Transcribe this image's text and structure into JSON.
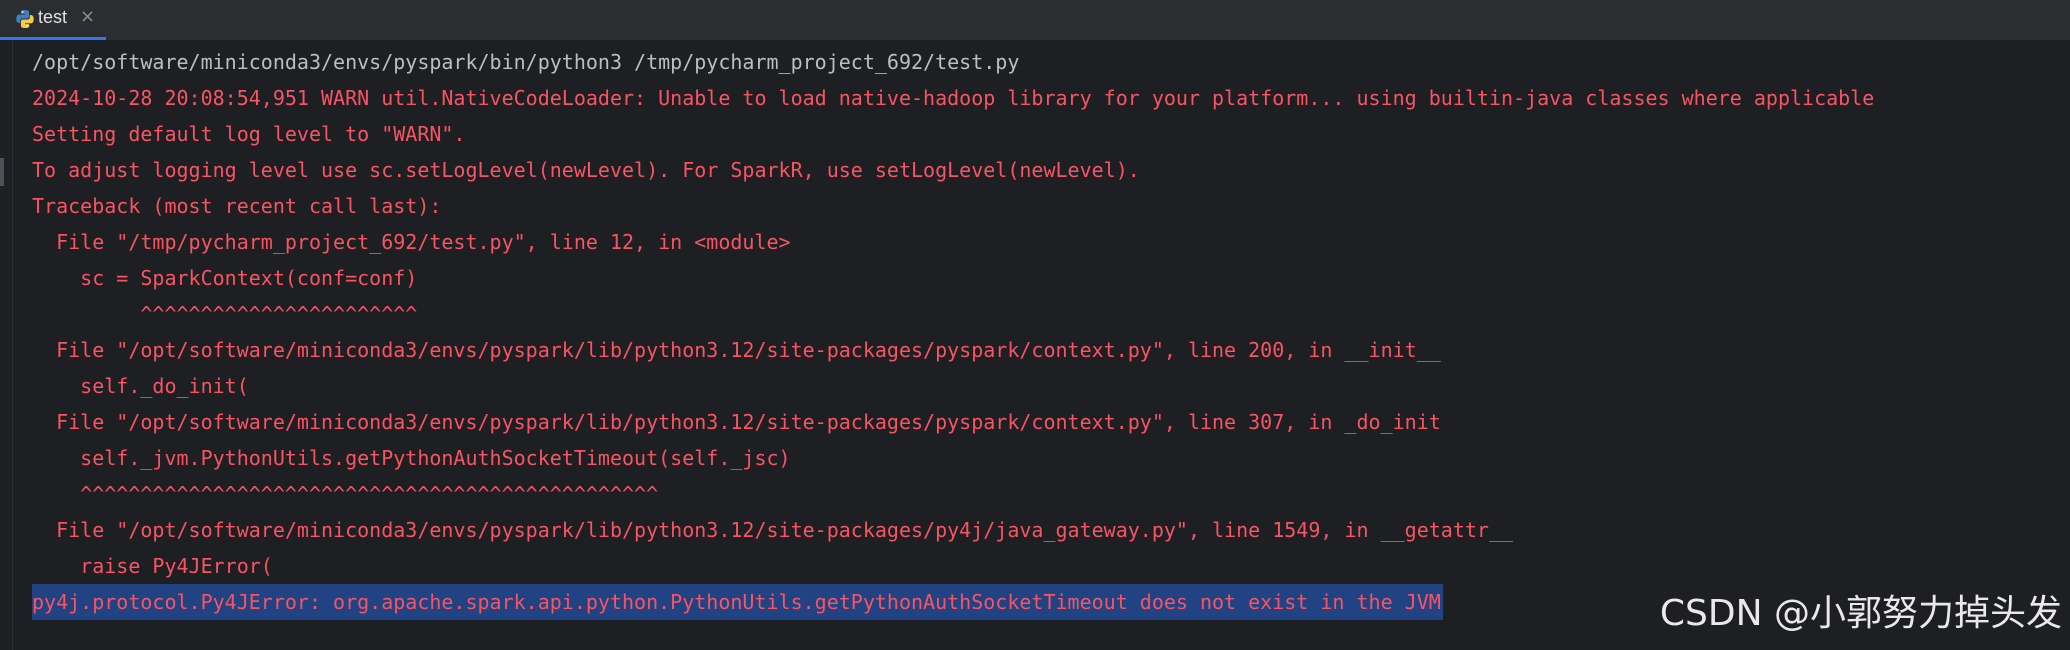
{
  "tab": {
    "label": "test",
    "close_glyph": "×",
    "icon": "python-icon"
  },
  "console": {
    "lines": [
      "/opt/software/miniconda3/envs/pyspark/bin/python3 /tmp/pycharm_project_692/test.py",
      "2024-10-28 20:08:54,951 WARN util.NativeCodeLoader: Unable to load native-hadoop library for your platform... using builtin-java classes where applicable",
      "Setting default log level to \"WARN\".",
      "To adjust logging level use sc.setLogLevel(newLevel). For SparkR, use setLogLevel(newLevel).",
      "Traceback (most recent call last):",
      "  File \"/tmp/pycharm_project_692/test.py\", line 12, in <module>",
      "    sc = SparkContext(conf=conf)",
      "         ^^^^^^^^^^^^^^^^^^^^^^^",
      "  File \"/opt/software/miniconda3/envs/pyspark/lib/python3.12/site-packages/pyspark/context.py\", line 200, in __init__",
      "    self._do_init(",
      "  File \"/opt/software/miniconda3/envs/pyspark/lib/python3.12/site-packages/pyspark/context.py\", line 307, in _do_init",
      "    self._jvm.PythonUtils.getPythonAuthSocketTimeout(self._jsc)",
      "    ^^^^^^^^^^^^^^^^^^^^^^^^^^^^^^^^^^^^^^^^^^^^^^^^",
      "  File \"/opt/software/miniconda3/envs/pyspark/lib/python3.12/site-packages/py4j/java_gateway.py\", line 1549, in __getattr__",
      "    raise Py4JError(",
      "py4j.protocol.Py4JError: org.apache.spark.api.python.PythonUtils.getPythonAuthSocketTimeout does not exist in the JVM"
    ]
  },
  "watermark": "CSDN @小郭努力掉头发",
  "colors": {
    "background": "#1e1f22",
    "tabbar": "#2b2d30",
    "accent": "#3574f0",
    "error_text": "#f75464",
    "command_text": "#bcbec4",
    "selection": "#214283"
  }
}
